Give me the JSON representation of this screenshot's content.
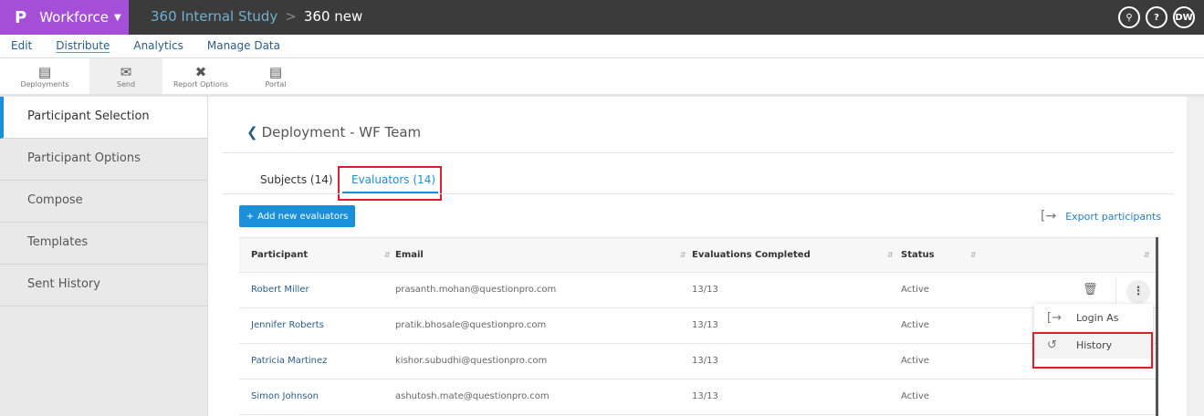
{
  "topbar": {
    "brand": "Workforce",
    "logo": "P",
    "breadcrumb_parent": "360 Internal Study",
    "breadcrumb_current": "360 new",
    "icons": [
      "search-icon",
      "help-icon"
    ],
    "avatar": "DW"
  },
  "menu": [
    "Edit",
    "Distribute",
    "Analytics",
    "Manage Data"
  ],
  "toolbar": [
    {
      "label": "Deployments",
      "icon": "list-icon"
    },
    {
      "label": "Send",
      "icon": "mail-send-icon"
    },
    {
      "label": "Report Options",
      "icon": "tools-icon"
    },
    {
      "label": "Portal",
      "icon": "message-icon"
    }
  ],
  "sidebar": [
    "Participant Selection",
    "Participant Options",
    "Compose",
    "Templates",
    "Sent History"
  ],
  "page": {
    "title": "Deployment - WF Team",
    "tabs": [
      "Subjects (14)",
      "Evaluators (14)"
    ],
    "add_button": "Add new evaluators",
    "export": "Export participants"
  },
  "table": {
    "headers": [
      "Participant",
      "Email",
      "Evaluations Completed",
      "Status"
    ],
    "rows": [
      [
        "Robert Miller",
        "prasanth.mohan@questionpro.com",
        "13/13",
        "Active"
      ],
      [
        "Jennifer Roberts",
        "pratik.bhosale@questionpro.com",
        "13/13",
        "Active"
      ],
      [
        "Patricia Martinez",
        "kishor.subudhi@questionpro.com",
        "13/13",
        "Active"
      ],
      [
        "Simon Johnson",
        "ashutosh.mate@questionpro.com",
        "13/13",
        "Active"
      ]
    ]
  },
  "context_menu": [
    "Login As",
    "History"
  ],
  "colors": {
    "brand": "#a54fd9",
    "accent": "#1b8fd8",
    "highlight": "#d9212b"
  }
}
